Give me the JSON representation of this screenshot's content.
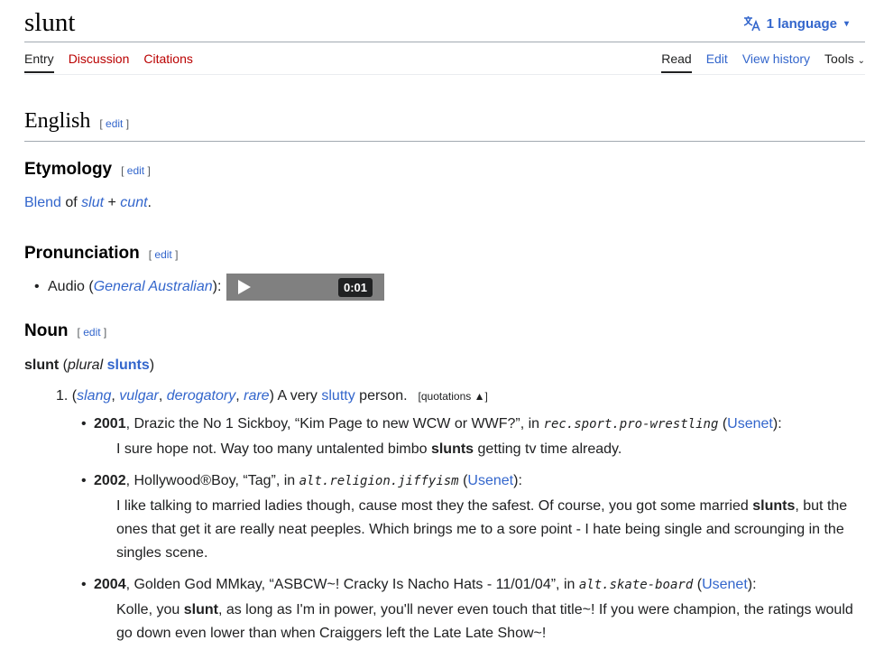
{
  "header": {
    "title": "slunt",
    "language_button": "1 language",
    "tabs_left": [
      "Entry",
      "Discussion",
      "Citations"
    ],
    "tabs_right": [
      "Read",
      "Edit",
      "View history",
      "Tools"
    ]
  },
  "edit_label": "edit",
  "sections": {
    "language": "English",
    "etymology": {
      "heading": "Etymology",
      "blend": "Blend",
      "of": " of ",
      "word1": "slut",
      "plus": " + ",
      "word2": "cunt",
      "end": "."
    },
    "pronunciation": {
      "heading": "Pronunciation",
      "audio_label": "Audio (",
      "accent": "General Australian",
      "audio_end": "):",
      "duration": "0:01"
    },
    "noun": {
      "heading": "Noun",
      "headword": "slunt",
      "plural_open": " (",
      "plural_label": "plural",
      "plural_form": "slunts",
      "plural_close": ")",
      "sense_number": "1.",
      "labels": [
        "slang",
        "vulgar",
        "derogatory",
        "rare"
      ],
      "definition_pre": ") A very ",
      "definition_link": "slutty",
      "definition_post": " person.",
      "quotations_toggle": "[quotations ▲]"
    }
  },
  "quotations": [
    {
      "year": "2001",
      "author": ", Drazic the No 1 Sickboy, “Kim Page to new WCW or WWF?”, in ",
      "group": "rec.sport.pro-wrestling",
      "source_open": " (",
      "source": "Usenet",
      "source_close": "):",
      "text_pre": "I sure hope not. Way too many untalented bimbo ",
      "text_bold": "slunts",
      "text_post": " getting tv time already."
    },
    {
      "year": "2002",
      "author": ", Hollywood®Boy, “Tag”, in ",
      "group": "alt.religion.jiffyism",
      "source_open": " (",
      "source": "Usenet",
      "source_close": "):",
      "text_pre": "I like talking to married ladies though, cause most they the safest. Of course, you got some married ",
      "text_bold": "slunts",
      "text_post": ", but the ones that get it are really neat peeples. Which brings me to a sore point - I hate being single and scrounging in the singles scene."
    },
    {
      "year": "2004",
      "author": ", Golden God MMkay, “ASBCW~! Cracky Is Nacho Hats - 11/01/04”, in ",
      "group": "alt.skate-board",
      "source_open": " (",
      "source": "Usenet",
      "source_close": "):",
      "text_pre": "Kolle, you ",
      "text_bold": "slunt",
      "text_post": ", as long as I'm in power, you'll never even touch that title~! If you were champion, the ratings would go down even lower than when Craiggers left the Late Late Show~!"
    }
  ]
}
